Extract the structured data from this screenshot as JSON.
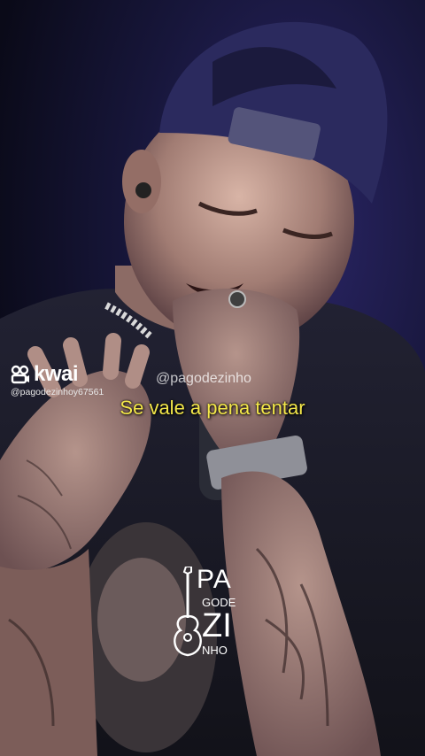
{
  "overlay": {
    "kwai_brand": "kwai",
    "kwai_username": "@pagodezinhoy67561",
    "channel_handle": "@pagodezinho",
    "lyric_caption": "Se vale a pena tentar"
  },
  "watermark": {
    "line1": "PA",
    "line2": "GODE",
    "line3": "ZI",
    "line4": "NHO"
  },
  "colors": {
    "caption": "#f4e84a",
    "background": "#17163a",
    "cap": "#2b2a5e"
  }
}
